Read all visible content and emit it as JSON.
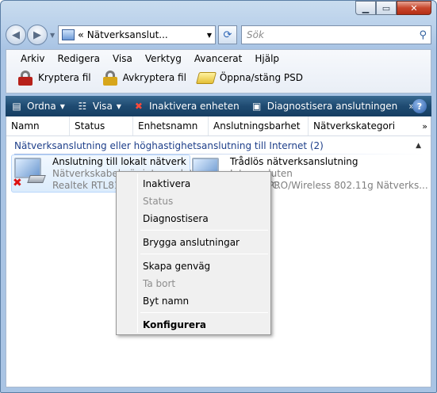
{
  "address": {
    "chevron": "«",
    "path": "Nätverksanslut...",
    "dropdown_icon": "chevron-down-icon"
  },
  "search": {
    "placeholder": "Sök"
  },
  "menu": [
    "Arkiv",
    "Redigera",
    "Visa",
    "Verktyg",
    "Avancerat",
    "Hjälp"
  ],
  "tools": {
    "encrypt": "Kryptera fil",
    "decrypt": "Avkryptera fil",
    "psd": "Öppna/stäng PSD"
  },
  "commands": {
    "organize": "Ordna",
    "view": "Visa",
    "disable": "Inaktivera enheten",
    "diagnose": "Diagnostisera anslutningen",
    "more": "»"
  },
  "columns": [
    "Namn",
    "Status",
    "Enhetsnamn",
    "Anslutningsbarhet",
    "Nätverkskategori"
  ],
  "group": {
    "title": "Nätverksanslutning eller höghastighetsanslutning till Internet (2)"
  },
  "connections": [
    {
      "name": "Anslutning till lokalt nätverk",
      "status": "Nätverkskabeln är inte ansluten",
      "device": "Realtek RTL8139/810x Family Fast Ethernet NIC"
    },
    {
      "name": "Trådlös nätverksanslutning",
      "status": "Inte ansluten",
      "device": "Intel(R) PRO/Wireless 802.11g Nätverks..."
    }
  ],
  "context_menu": {
    "items": [
      {
        "label": "Inaktivera",
        "state": "enabled"
      },
      {
        "label": "Status",
        "state": "disabled"
      },
      {
        "label": "Diagnostisera",
        "state": "enabled"
      },
      {
        "label": "Brygga anslutningar",
        "state": "enabled"
      },
      {
        "label": "Skapa genväg",
        "state": "enabled"
      },
      {
        "label": "Ta bort",
        "state": "disabled"
      },
      {
        "label": "Byt namn",
        "state": "enabled"
      },
      {
        "label": "Konfigurera",
        "state": "default"
      }
    ]
  },
  "colors": {
    "command_bar": "#1e4a71",
    "group_header": "#1e3f8a",
    "disabled_text": "#8d8d8d"
  }
}
